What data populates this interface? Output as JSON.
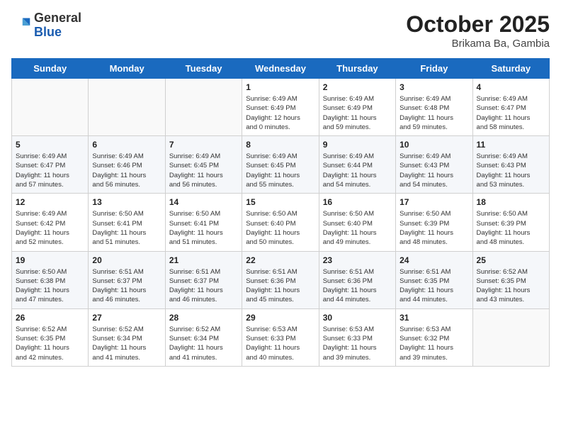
{
  "header": {
    "logo_general": "General",
    "logo_blue": "Blue",
    "title": "October 2025",
    "subtitle": "Brikama Ba, Gambia"
  },
  "weekdays": [
    "Sunday",
    "Monday",
    "Tuesday",
    "Wednesday",
    "Thursday",
    "Friday",
    "Saturday"
  ],
  "weeks": [
    [
      {
        "day": "",
        "info": ""
      },
      {
        "day": "",
        "info": ""
      },
      {
        "day": "",
        "info": ""
      },
      {
        "day": "1",
        "info": "Sunrise: 6:49 AM\nSunset: 6:49 PM\nDaylight: 12 hours\nand 0 minutes."
      },
      {
        "day": "2",
        "info": "Sunrise: 6:49 AM\nSunset: 6:49 PM\nDaylight: 11 hours\nand 59 minutes."
      },
      {
        "day": "3",
        "info": "Sunrise: 6:49 AM\nSunset: 6:48 PM\nDaylight: 11 hours\nand 59 minutes."
      },
      {
        "day": "4",
        "info": "Sunrise: 6:49 AM\nSunset: 6:47 PM\nDaylight: 11 hours\nand 58 minutes."
      }
    ],
    [
      {
        "day": "5",
        "info": "Sunrise: 6:49 AM\nSunset: 6:47 PM\nDaylight: 11 hours\nand 57 minutes."
      },
      {
        "day": "6",
        "info": "Sunrise: 6:49 AM\nSunset: 6:46 PM\nDaylight: 11 hours\nand 56 minutes."
      },
      {
        "day": "7",
        "info": "Sunrise: 6:49 AM\nSunset: 6:45 PM\nDaylight: 11 hours\nand 56 minutes."
      },
      {
        "day": "8",
        "info": "Sunrise: 6:49 AM\nSunset: 6:45 PM\nDaylight: 11 hours\nand 55 minutes."
      },
      {
        "day": "9",
        "info": "Sunrise: 6:49 AM\nSunset: 6:44 PM\nDaylight: 11 hours\nand 54 minutes."
      },
      {
        "day": "10",
        "info": "Sunrise: 6:49 AM\nSunset: 6:43 PM\nDaylight: 11 hours\nand 54 minutes."
      },
      {
        "day": "11",
        "info": "Sunrise: 6:49 AM\nSunset: 6:43 PM\nDaylight: 11 hours\nand 53 minutes."
      }
    ],
    [
      {
        "day": "12",
        "info": "Sunrise: 6:49 AM\nSunset: 6:42 PM\nDaylight: 11 hours\nand 52 minutes."
      },
      {
        "day": "13",
        "info": "Sunrise: 6:50 AM\nSunset: 6:41 PM\nDaylight: 11 hours\nand 51 minutes."
      },
      {
        "day": "14",
        "info": "Sunrise: 6:50 AM\nSunset: 6:41 PM\nDaylight: 11 hours\nand 51 minutes."
      },
      {
        "day": "15",
        "info": "Sunrise: 6:50 AM\nSunset: 6:40 PM\nDaylight: 11 hours\nand 50 minutes."
      },
      {
        "day": "16",
        "info": "Sunrise: 6:50 AM\nSunset: 6:40 PM\nDaylight: 11 hours\nand 49 minutes."
      },
      {
        "day": "17",
        "info": "Sunrise: 6:50 AM\nSunset: 6:39 PM\nDaylight: 11 hours\nand 48 minutes."
      },
      {
        "day": "18",
        "info": "Sunrise: 6:50 AM\nSunset: 6:39 PM\nDaylight: 11 hours\nand 48 minutes."
      }
    ],
    [
      {
        "day": "19",
        "info": "Sunrise: 6:50 AM\nSunset: 6:38 PM\nDaylight: 11 hours\nand 47 minutes."
      },
      {
        "day": "20",
        "info": "Sunrise: 6:51 AM\nSunset: 6:37 PM\nDaylight: 11 hours\nand 46 minutes."
      },
      {
        "day": "21",
        "info": "Sunrise: 6:51 AM\nSunset: 6:37 PM\nDaylight: 11 hours\nand 46 minutes."
      },
      {
        "day": "22",
        "info": "Sunrise: 6:51 AM\nSunset: 6:36 PM\nDaylight: 11 hours\nand 45 minutes."
      },
      {
        "day": "23",
        "info": "Sunrise: 6:51 AM\nSunset: 6:36 PM\nDaylight: 11 hours\nand 44 minutes."
      },
      {
        "day": "24",
        "info": "Sunrise: 6:51 AM\nSunset: 6:35 PM\nDaylight: 11 hours\nand 44 minutes."
      },
      {
        "day": "25",
        "info": "Sunrise: 6:52 AM\nSunset: 6:35 PM\nDaylight: 11 hours\nand 43 minutes."
      }
    ],
    [
      {
        "day": "26",
        "info": "Sunrise: 6:52 AM\nSunset: 6:35 PM\nDaylight: 11 hours\nand 42 minutes."
      },
      {
        "day": "27",
        "info": "Sunrise: 6:52 AM\nSunset: 6:34 PM\nDaylight: 11 hours\nand 41 minutes."
      },
      {
        "day": "28",
        "info": "Sunrise: 6:52 AM\nSunset: 6:34 PM\nDaylight: 11 hours\nand 41 minutes."
      },
      {
        "day": "29",
        "info": "Sunrise: 6:53 AM\nSunset: 6:33 PM\nDaylight: 11 hours\nand 40 minutes."
      },
      {
        "day": "30",
        "info": "Sunrise: 6:53 AM\nSunset: 6:33 PM\nDaylight: 11 hours\nand 39 minutes."
      },
      {
        "day": "31",
        "info": "Sunrise: 6:53 AM\nSunset: 6:32 PM\nDaylight: 11 hours\nand 39 minutes."
      },
      {
        "day": "",
        "info": ""
      }
    ]
  ]
}
